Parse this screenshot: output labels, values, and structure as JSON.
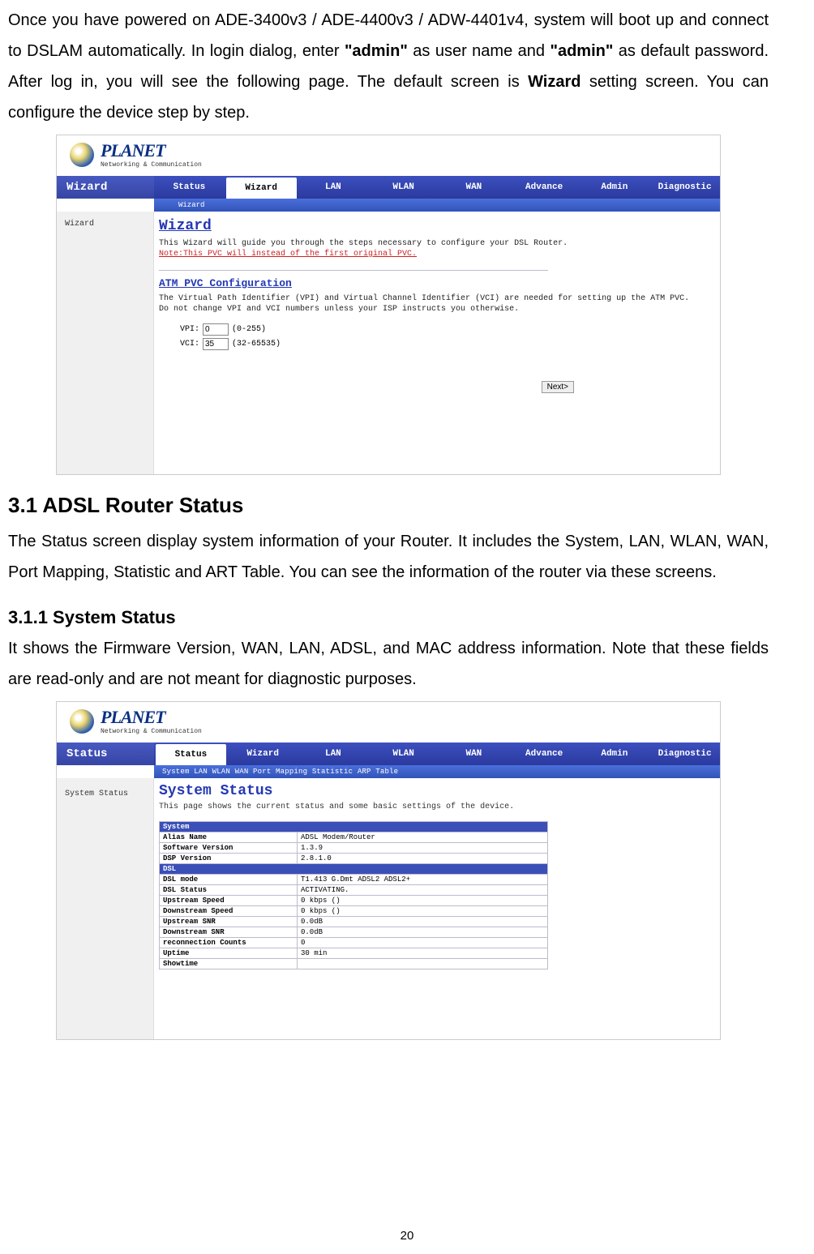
{
  "intro": {
    "prefix": "Once you have powered on ADE-3400v3 / ADE-4400v3 / ADW-4401v4, system will boot up and connect to DSLAM automatically. In login dialog, enter ",
    "admin1": "\"admin\"",
    "mid1": " as user name and ",
    "admin2": "\"admin\"",
    "mid2": " as default password. After log in, you will see the following page. The default screen is ",
    "wizard_bold": "Wizard",
    "suffix": " setting screen. You can configure the device step by step."
  },
  "logo": {
    "brand": "PLANET",
    "tagline": "Networking & Communication"
  },
  "wizard_shot": {
    "nav_title": "Wizard",
    "tabs": [
      "Status",
      "Wizard",
      "LAN",
      "WLAN",
      "WAN",
      "Advance",
      "Admin",
      "Diagnostic"
    ],
    "active_tab_index": 1,
    "subnav": "Wizard",
    "sidebar": "Wizard",
    "c_title": "Wizard",
    "c_intro": "This Wizard will guide you through the steps necessary to configure your DSL Router.",
    "c_note": "Note:This PVC will instead of the first original PVC.",
    "atm_title": "ATM PVC Configuration",
    "atm_p1": "The Virtual Path Identifier (VPI) and Virtual Channel Identifier (VCI) are needed for setting up the ATM PVC.",
    "atm_p2": "Do not change VPI and VCI numbers unless your ISP instructs you otherwise.",
    "vpi_label": "VPI:",
    "vpi_value": "0",
    "vpi_range": "(0-255)",
    "vci_label": "VCI:",
    "vci_value": "35",
    "vci_range": "(32-65535)",
    "next_btn": "Next>"
  },
  "h1_31": "3.1 ADSL Router Status",
  "p_31": "The Status screen display system information of your Router. It includes the System, LAN, WLAN, WAN, Port Mapping, Statistic and ART Table. You can see the information of the router via these screens.",
  "h2_311": "3.1.1 System Status",
  "p_311": "It shows the Firmware Version, WAN, LAN, ADSL, and MAC address information. Note that these fields are read-only and are not meant for diagnostic purposes.",
  "status_shot": {
    "nav_title": "Status",
    "tabs": [
      "Status",
      "Wizard",
      "LAN",
      "WLAN",
      "WAN",
      "Advance",
      "Admin",
      "Diagnostic"
    ],
    "active_tab_index": 0,
    "subnav": "System  LAN  WLAN  WAN  Port Mapping  Statistic  ARP Table",
    "sidebar": "System Status",
    "c_title": "System Status",
    "c_sub": "This page shows the current status and some basic settings of the device.",
    "sections": [
      {
        "title": "System",
        "rows": [
          [
            "Alias Name",
            "ADSL Modem/Router"
          ],
          [
            "Software Version",
            "1.3.9"
          ],
          [
            "DSP Version",
            "2.8.1.0"
          ]
        ]
      },
      {
        "title": "DSL",
        "rows": [
          [
            "DSL mode",
            "T1.413 G.Dmt ADSL2 ADSL2+"
          ],
          [
            "DSL Status",
            "ACTIVATING."
          ],
          [
            "Upstream Speed",
            "0 kbps  ()"
          ],
          [
            "Downstream Speed",
            "0 kbps  ()"
          ],
          [
            "Upstream SNR",
            "0.0dB"
          ],
          [
            "Downstream SNR",
            "0.0dB"
          ],
          [
            "reconnection Counts",
            "0"
          ],
          [
            "Uptime",
            "30 min"
          ],
          [
            "Showtime",
            ""
          ]
        ]
      }
    ]
  },
  "page_number": "20"
}
